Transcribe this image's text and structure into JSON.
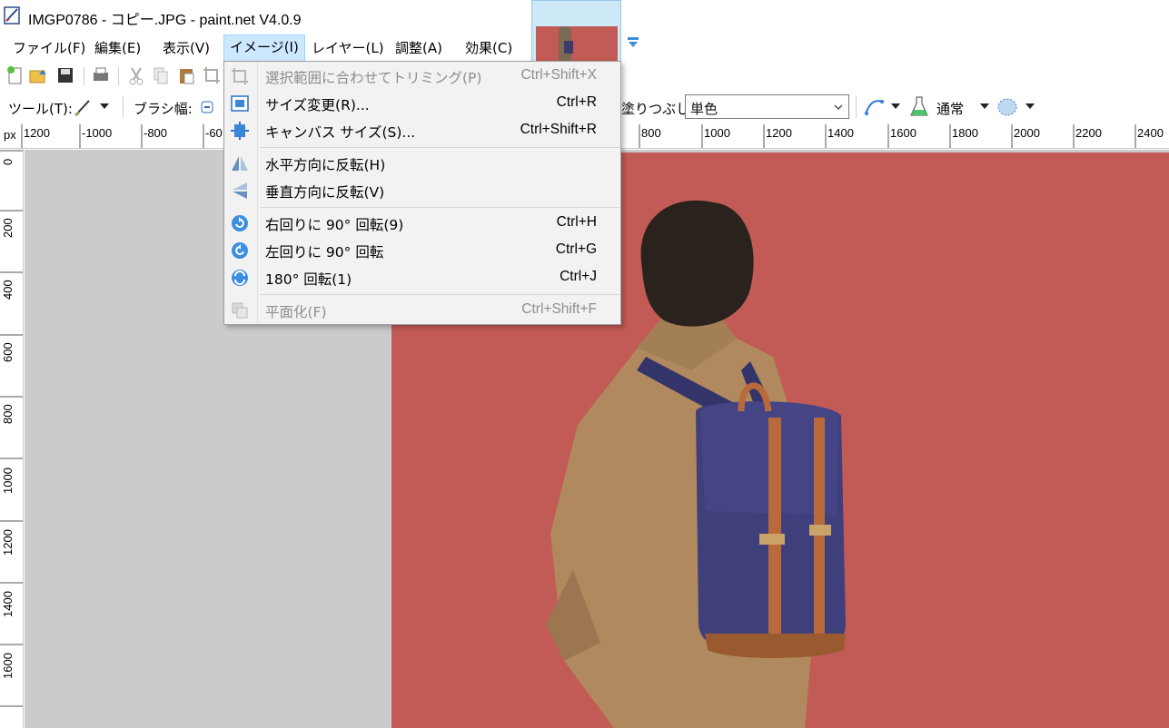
{
  "window": {
    "title": "IMGP0786 - コピー.JPG - paint.net V4.0.9"
  },
  "menubar": {
    "items": [
      {
        "label": "ファイル(F)"
      },
      {
        "label": "編集(E)"
      },
      {
        "label": "表示(V)"
      },
      {
        "label": "イメージ(I)",
        "active": true
      },
      {
        "label": "レイヤー(L)"
      },
      {
        "label": "調整(A)"
      },
      {
        "label": "効果(C)"
      }
    ]
  },
  "toolbar2": {
    "tool_label": "ツール(T):",
    "brush_width_label": "ブラシ幅:",
    "fill_label": "塗りつぶし:",
    "fill_value": "単色",
    "blend_mode": "通常"
  },
  "ruler": {
    "unit": "px",
    "h_labels": [
      "1200",
      "-1000",
      "-800",
      "-60",
      "800",
      "1000",
      "1200",
      "1400",
      "1600",
      "1800",
      "2000",
      "2200",
      "2400"
    ],
    "v_labels": [
      "0",
      "200",
      "400",
      "600",
      "800",
      "1000",
      "1200",
      "1400",
      "1600"
    ]
  },
  "image_menu": {
    "items": [
      {
        "label": "選択範囲に合わせてトリミング(P)",
        "shortcut": "Ctrl+Shift+X",
        "icon": "crop-icon",
        "disabled": true
      },
      {
        "label": "サイズ変更(R)...",
        "shortcut": "Ctrl+R",
        "icon": "resize-icon",
        "disabled": false
      },
      {
        "label": "キャンバス サイズ(S)...",
        "shortcut": "Ctrl+Shift+R",
        "icon": "canvas-size-icon",
        "disabled": false
      },
      {
        "label": "水平方向に反転(H)",
        "shortcut": "",
        "icon": "flip-horizontal-icon",
        "disabled": false
      },
      {
        "label": "垂直方向に反転(V)",
        "shortcut": "",
        "icon": "flip-vertical-icon",
        "disabled": false
      },
      {
        "label": "右回りに 90° 回転(9)",
        "shortcut": "Ctrl+H",
        "icon": "rotate-cw-icon",
        "disabled": false
      },
      {
        "label": "左回りに 90° 回転",
        "shortcut": "Ctrl+G",
        "icon": "rotate-ccw-icon",
        "disabled": false
      },
      {
        "label": "180° 回転(1)",
        "shortcut": "Ctrl+J",
        "icon": "rotate-180-icon",
        "disabled": false
      },
      {
        "label": "平面化(F)",
        "shortcut": "Ctrl+Shift+F",
        "icon": "flatten-icon",
        "disabled": true
      }
    ]
  },
  "colors": {
    "wall": "#c25b55",
    "workspace": "#cbcbcb",
    "menu_active": "#cce8ff"
  }
}
